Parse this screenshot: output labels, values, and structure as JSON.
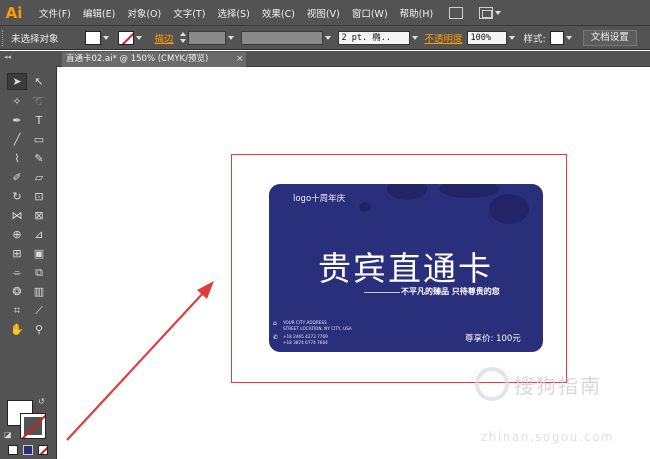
{
  "app": {
    "logo": "Ai"
  },
  "menu": [
    "文件(F)",
    "编辑(E)",
    "对象(O)",
    "文字(T)",
    "选择(S)",
    "效果(C)",
    "视图(V)",
    "窗口(W)",
    "帮助(H)"
  ],
  "control_bar": {
    "selection_label": "未选择对象",
    "stroke_label": "描边",
    "stroke_weight": " 2 pt. 椭..",
    "opacity_label": "不透明度",
    "opacity_value": "100%",
    "style_label": "样式:",
    "doc_settings": "文档设置"
  },
  "document_tab": {
    "title": "直通卡02.ai* @ 150% (CMYK/预览)",
    "close": "×"
  },
  "card": {
    "logo_text": "logo十周年庆",
    "title": "贵宾直通卡",
    "subtitle": "不平凡的臻品 只待尊贵的您",
    "info_lines": [
      "YOUR CITY ADDRESS",
      "STREET LOCATION, NY CITY, USA",
      "+18 2465 4273 7769",
      "+18 3874 6774 7664"
    ],
    "price": "尊享价: 100元"
  },
  "watermark": {
    "text": "搜狗指南",
    "url": "zhinan.sogou.com"
  },
  "colors": {
    "chrome": "#535353",
    "card_blue": "#2a2f7c",
    "artboard_border": "#e23b3b",
    "arrow": "#e23b3b",
    "accent_orange": "#ff9a00"
  },
  "icons": {
    "tools": [
      "selection-tool-icon",
      "direct-selection-tool-icon",
      "magic-wand-icon",
      "lasso-icon",
      "pen-tool-icon",
      "type-tool-icon",
      "line-tool-icon",
      "rectangle-tool-icon",
      "paintbrush-icon",
      "pencil-icon",
      "blob-brush-icon",
      "eraser-icon",
      "rotate-icon",
      "scale-icon",
      "width-tool-icon",
      "free-transform-icon",
      "shape-builder-icon",
      "perspective-icon",
      "mesh-icon",
      "gradient-icon",
      "eyedropper-icon",
      "blend-icon",
      "symbol-sprayer-icon",
      "column-graph-icon",
      "artboard-icon",
      "slice-icon",
      "hand-icon",
      "zoom-icon"
    ]
  }
}
